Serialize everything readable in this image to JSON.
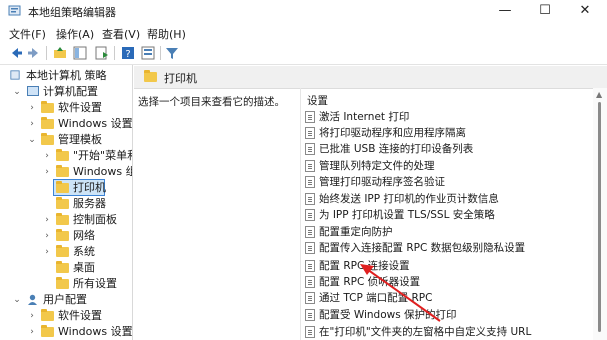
{
  "window": {
    "title": "本地组策略编辑器",
    "minimize": "—",
    "maximize": "☐",
    "close": "✕"
  },
  "menu": [
    "文件(F)",
    "操作(A)",
    "查看(V)",
    "帮助(H)"
  ],
  "tree": {
    "root": "本地计算机 策略",
    "computer_config": "计算机配置",
    "software_settings": "软件设置",
    "windows_settings": "Windows 设置",
    "admin_templates": "管理模板",
    "start_menu": "\"开始\"菜单和",
    "windows_components": "Windows 组",
    "printers": "打印机",
    "server": "服务器",
    "control_panel": "控制面板",
    "network": "网络",
    "system": "系统",
    "desktop": "桌面",
    "all_settings": "所有设置",
    "user_config": "用户配置",
    "user_software_settings": "软件设置",
    "user_windows_settings": "Windows 设置"
  },
  "content": {
    "folder_title": "打印机",
    "description": "选择一个项目来查看它的描述。",
    "column_header": "设置",
    "settings": [
      "激活 Internet 打印",
      "将打印驱动程序和应用程序隔离",
      "已批准 USB 连接的打印设备列表",
      "管理队列特定文件的处理",
      "管理打印驱动程序签名验证",
      "始终发送 IPP 打印机的作业页计数信息",
      "为 IPP 打印机设置 TLS/SSL 安全策略",
      "配置重定向防护",
      "配置传入连接配置 RPC 数据包级别隐私设置",
      "配置 RPC 连接设置",
      "配置 RPC 侦听器设置",
      "通过 TCP 端口配置 RPC",
      "配置受 Windows 保护的打印",
      "在\"打印机\"文件夹的左窗格中自定义支持 URL"
    ]
  },
  "colors": {
    "selection": "#cde4f7",
    "selection_border": "#3b83d6",
    "arrow": "#e02020"
  }
}
